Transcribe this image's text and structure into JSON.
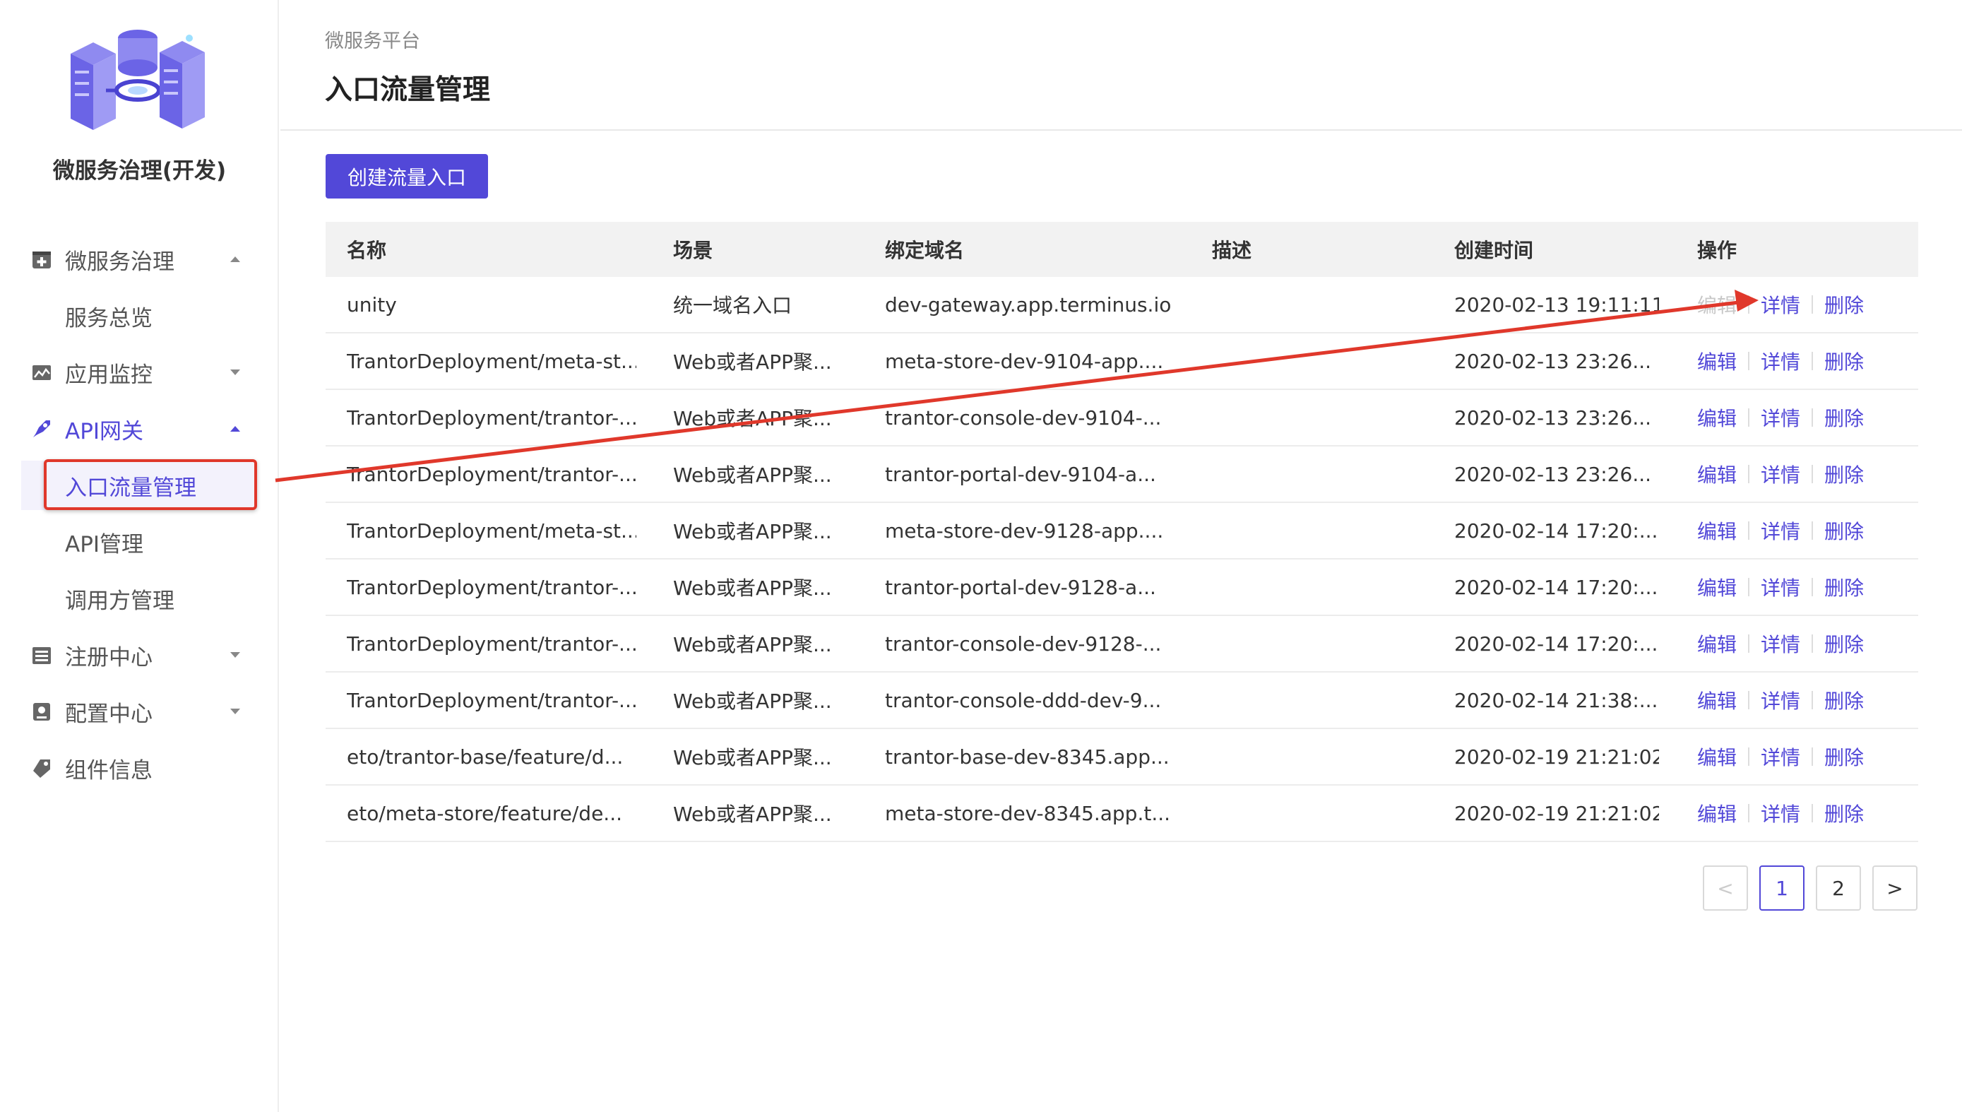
{
  "sidebar": {
    "app_title": "微服务治理(开发)",
    "groups": [
      {
        "label": "微服务治理",
        "icon": "plus-box-icon",
        "expanded": true
      },
      {
        "label": "服务总览"
      },
      {
        "label": "应用监控",
        "icon": "chart-image-icon",
        "expanded": false
      },
      {
        "label": "API网关",
        "icon": "rocket-icon",
        "expanded": true
      },
      {
        "label": "入口流量管理"
      },
      {
        "label": "API管理"
      },
      {
        "label": "调用方管理"
      },
      {
        "label": "注册中心",
        "icon": "server-icon",
        "expanded": false
      },
      {
        "label": "配置中心",
        "icon": "config-icon",
        "expanded": false
      },
      {
        "label": "组件信息",
        "icon": "puzzle-icon"
      }
    ]
  },
  "header": {
    "breadcrumb": "微服务平台",
    "title": "入口流量管理"
  },
  "toolbar": {
    "create_label": "创建流量入口"
  },
  "table": {
    "columns": [
      "名称",
      "场景",
      "绑定域名",
      "描述",
      "创建时间",
      "操作"
    ],
    "ops": {
      "edit": "编辑",
      "detail": "详情",
      "delete": "删除"
    },
    "rows": [
      {
        "name": "unity",
        "scene": "统一域名入口",
        "domain": "dev-gateway.app.terminus.io",
        "desc": "",
        "time": "2020-02-13 19:11:11"
      },
      {
        "name": "TrantorDeployment/meta-st...",
        "scene": "Web或者APP聚...",
        "domain": "meta-store-dev-9104-app....",
        "desc": "",
        "time": "2020-02-13 23:26..."
      },
      {
        "name": "TrantorDeployment/trantor-...",
        "scene": "Web或者APP聚...",
        "domain": "trantor-console-dev-9104-...",
        "desc": "",
        "time": "2020-02-13 23:26..."
      },
      {
        "name": "TrantorDeployment/trantor-...",
        "scene": "Web或者APP聚...",
        "domain": "trantor-portal-dev-9104-a...",
        "desc": "",
        "time": "2020-02-13 23:26..."
      },
      {
        "name": "TrantorDeployment/meta-st...",
        "scene": "Web或者APP聚...",
        "domain": "meta-store-dev-9128-app....",
        "desc": "",
        "time": "2020-02-14 17:20:..."
      },
      {
        "name": "TrantorDeployment/trantor-...",
        "scene": "Web或者APP聚...",
        "domain": "trantor-portal-dev-9128-a...",
        "desc": "",
        "time": "2020-02-14 17:20:..."
      },
      {
        "name": "TrantorDeployment/trantor-...",
        "scene": "Web或者APP聚...",
        "domain": "trantor-console-dev-9128-...",
        "desc": "",
        "time": "2020-02-14 17:20:..."
      },
      {
        "name": "TrantorDeployment/trantor-...",
        "scene": "Web或者APP聚...",
        "domain": "trantor-console-ddd-dev-9...",
        "desc": "",
        "time": "2020-02-14 21:38:..."
      },
      {
        "name": "eto/trantor-base/feature/d...",
        "scene": "Web或者APP聚...",
        "domain": "trantor-base-dev-8345.app...",
        "desc": "",
        "time": "2020-02-19 21:21:02"
      },
      {
        "name": "eto/meta-store/feature/de...",
        "scene": "Web或者APP聚...",
        "domain": "meta-store-dev-8345.app.t...",
        "desc": "",
        "time": "2020-02-19 21:21:02"
      }
    ]
  },
  "pagination": {
    "prev": "<",
    "pages": [
      "1",
      "2"
    ],
    "current": "1",
    "next": ">"
  },
  "colors": {
    "accent": "#5248d8",
    "annotation": "#e0382b"
  }
}
